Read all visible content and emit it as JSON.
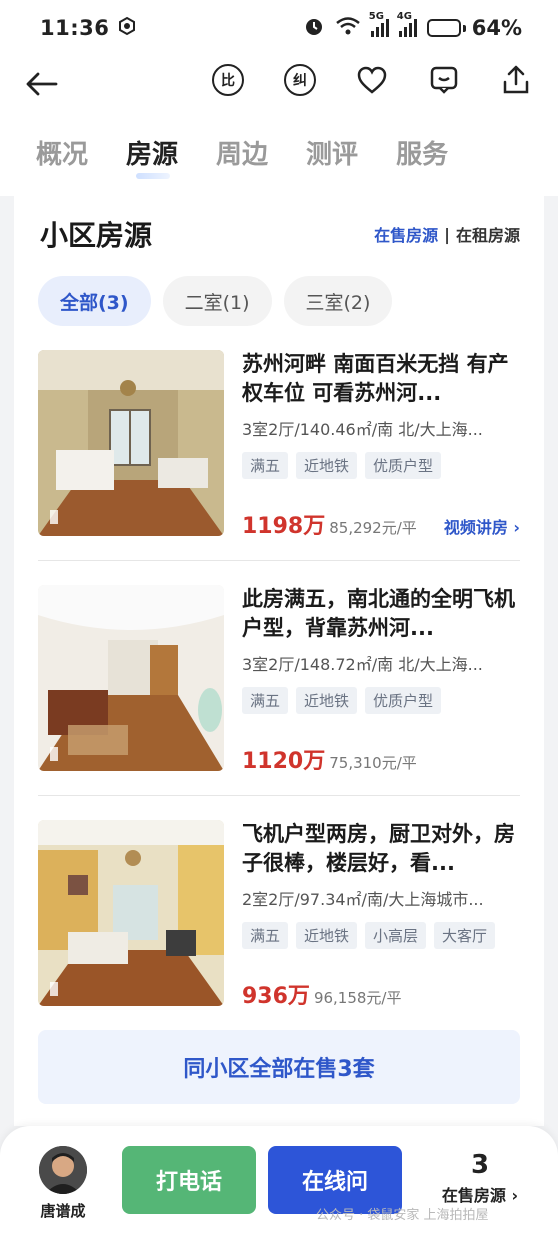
{
  "status": {
    "time": "11:36",
    "battery": "64%",
    "battery_level": 0.64,
    "net1": "5G",
    "net2": "4G"
  },
  "tabs": [
    {
      "label": "概况",
      "active": false
    },
    {
      "label": "房源",
      "active": true
    },
    {
      "label": "周边",
      "active": false
    },
    {
      "label": "测评",
      "active": false
    },
    {
      "label": "服务",
      "active": false
    }
  ],
  "nav_icons": {
    "compare": "比",
    "correct": "纠"
  },
  "section": {
    "title": "小区房源",
    "link_sale": "在售房源",
    "separator": "|",
    "link_rent": "在租房源"
  },
  "filters": [
    {
      "label": "全部(3)",
      "active": true
    },
    {
      "label": "二室(1)",
      "active": false
    },
    {
      "label": "三室(2)",
      "active": false
    }
  ],
  "listings": [
    {
      "title": "苏州河畔 南面百米无挡 有产权车位 可看苏州河...",
      "meta": "3室2厅/140.46㎡/南 北/大上海...",
      "tags": [
        "满五",
        "近地铁",
        "优质户型"
      ],
      "price": "1198万",
      "unit_price": "85,292元/平",
      "video": "视频讲房 ›"
    },
    {
      "title": "此房满五，南北通的全明飞机户型，背靠苏州河...",
      "meta": "3室2厅/148.72㎡/南 北/大上海...",
      "tags": [
        "满五",
        "近地铁",
        "优质户型"
      ],
      "price": "1120万",
      "unit_price": "75,310元/平",
      "video": ""
    },
    {
      "title": "飞机户型两房，厨卫对外，房子很棒，楼层好，看...",
      "meta": "2室2厅/97.34㎡/南/大上海城市...",
      "tags": [
        "满五",
        "近地铁",
        "小高层",
        "大客厅"
      ],
      "price": "936万",
      "unit_price": "96,158元/平",
      "video": ""
    }
  ],
  "all_button": "同小区全部在售3套",
  "bottom": {
    "agent_name": "唐谱成",
    "call": "打电话",
    "online": "在线问",
    "count": "3",
    "count_label": "在售房源 ›",
    "watermark": "公众号 · 袋鼠安家 上海拍拍屋"
  },
  "colors": {
    "accent": "#2f57c9",
    "price": "#d0342c",
    "call_green": "#55b676",
    "online_blue": "#2d55d8"
  }
}
